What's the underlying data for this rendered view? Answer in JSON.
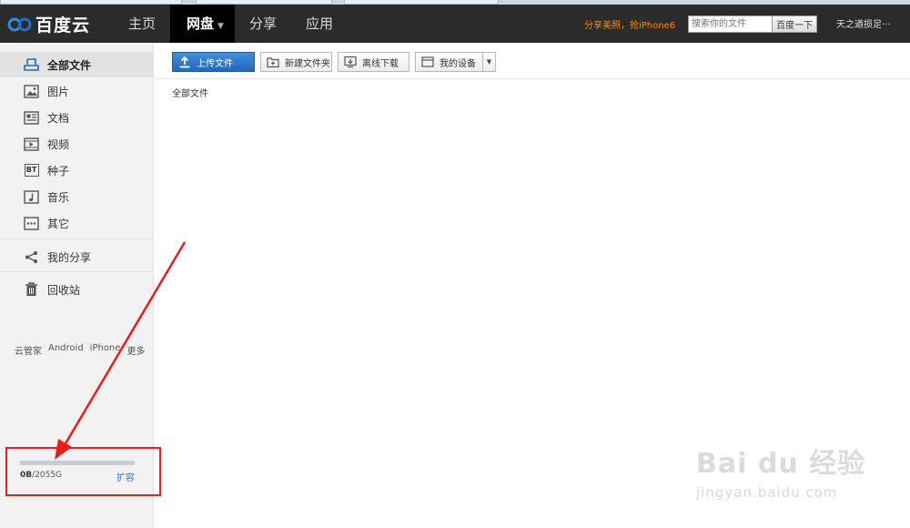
{
  "app": {
    "logo_text": "百度云"
  },
  "nav": {
    "items": [
      {
        "label": "主页"
      },
      {
        "label": "网盘"
      },
      {
        "label": "分享"
      },
      {
        "label": "应用"
      }
    ]
  },
  "header": {
    "promo": "分享美照，抢iPhone6",
    "search_placeholder": "搜索你的文件",
    "search_button": "百度一下",
    "user": "天之遒损足···"
  },
  "sidebar": {
    "items": [
      {
        "label": "全部文件",
        "icon": "cloud-upload-icon"
      },
      {
        "label": "图片",
        "icon": "image-icon"
      },
      {
        "label": "文档",
        "icon": "document-icon"
      },
      {
        "label": "视频",
        "icon": "video-icon"
      },
      {
        "label": "种子",
        "icon": "bt-icon",
        "icon_text": "BT"
      },
      {
        "label": "音乐",
        "icon": "music-icon"
      },
      {
        "label": "其它",
        "icon": "more-icon"
      },
      {
        "label": "我的分享",
        "icon": "share-icon"
      },
      {
        "label": "回收站",
        "icon": "trash-icon"
      }
    ],
    "clients": [
      "云管家",
      "Android",
      "iPhone",
      "更多"
    ],
    "quota": {
      "used": "0B",
      "total": "/2055G",
      "used_fraction": 0,
      "expand_label": "扩容"
    }
  },
  "toolbar": {
    "upload": "上传文件",
    "new_folder": "新建文件夹",
    "offline_download": "离线下载",
    "my_devices": "我的设备"
  },
  "breadcrumb": "全部文件",
  "watermark": {
    "brand": "Bai du 经验",
    "url": "jingyan.baidu.com"
  },
  "colors": {
    "topbar": "#2b2b2b",
    "accent": "#2467bd",
    "promo": "#ff8a00",
    "annotation": "#ee1b1b"
  }
}
